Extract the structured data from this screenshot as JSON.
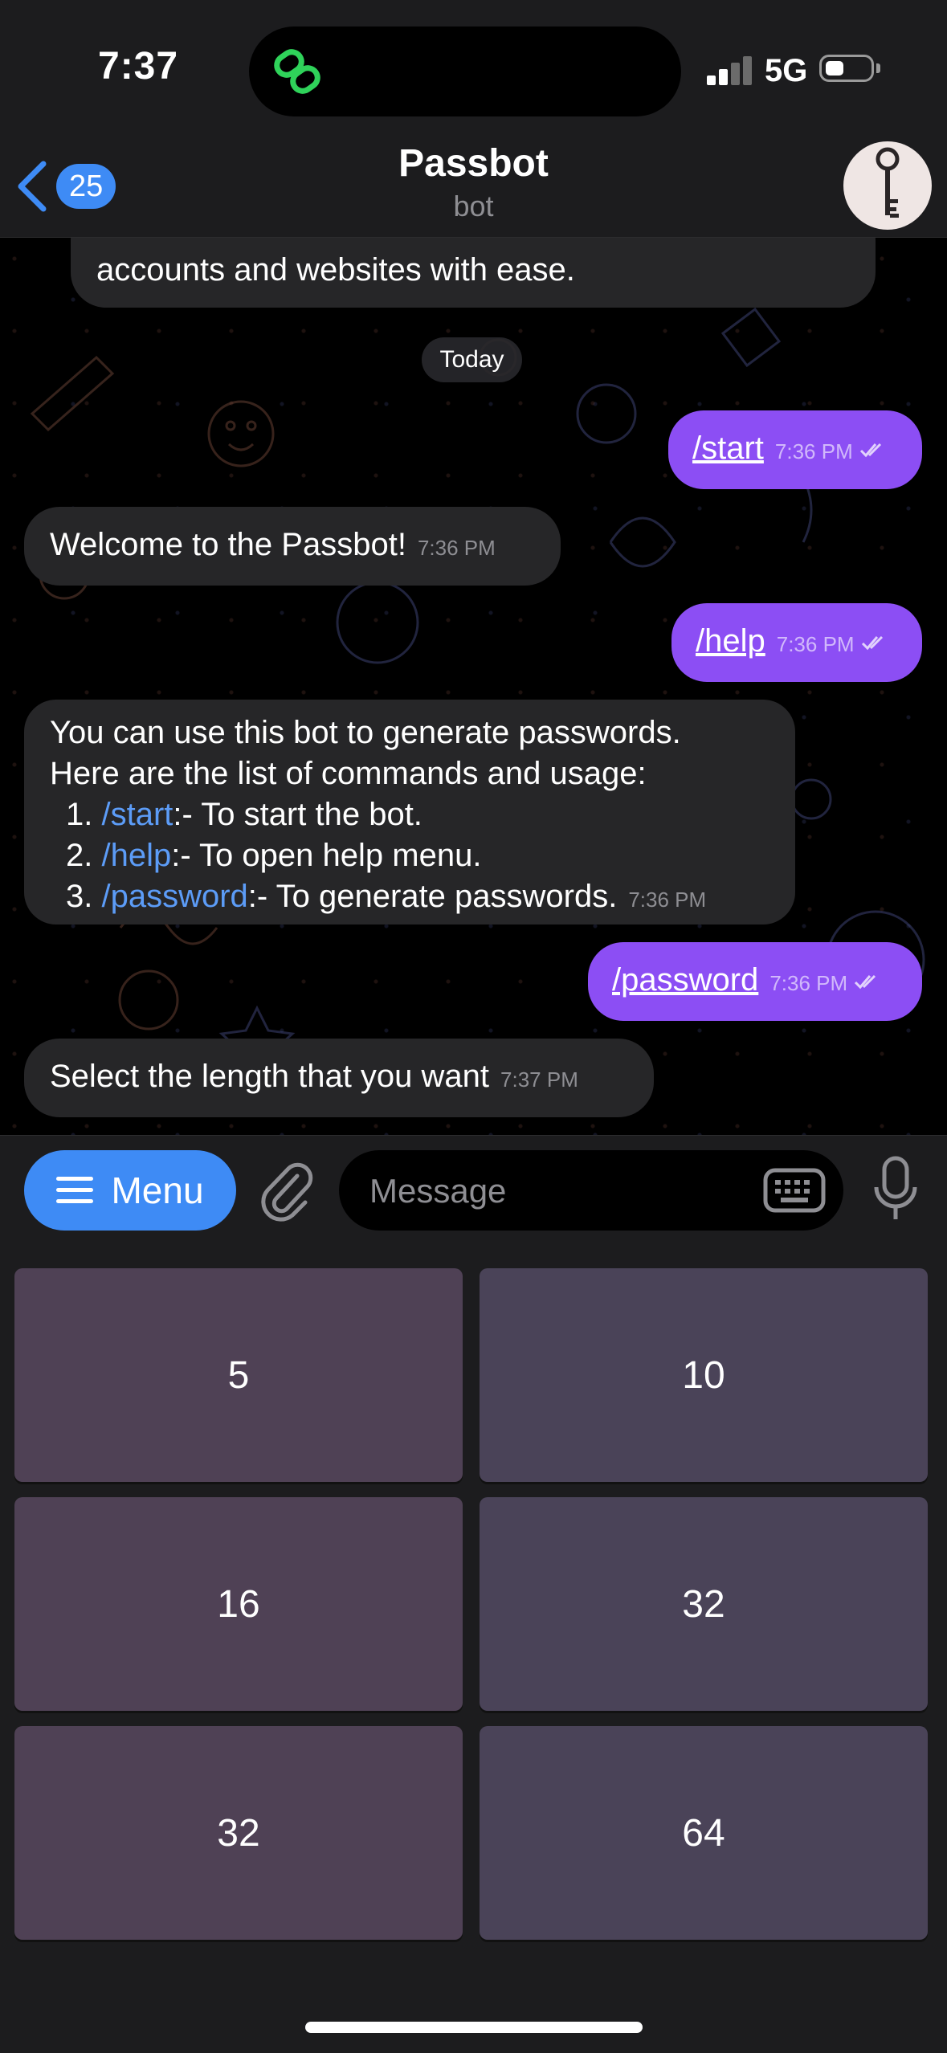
{
  "status_bar": {
    "time": "7:37",
    "network": "5G"
  },
  "header": {
    "back_badge": "25",
    "title": "Passbot",
    "subtitle": "bot"
  },
  "chat": {
    "intro_fragment": "accounts and websites with ease.",
    "date_divider": "Today",
    "messages": [
      {
        "dir": "out",
        "text": "/start",
        "time": "7:36 PM"
      },
      {
        "dir": "in",
        "text": "Welcome to the Passbot!",
        "time": "7:36 PM"
      },
      {
        "dir": "out",
        "text": "/help",
        "time": "7:36 PM"
      },
      {
        "dir": "in",
        "line1": "You can use this bot to generate passwords.",
        "line2": "Here are the list of commands and usage:",
        "items": [
          {
            "num": "1.",
            "cmd": "/start",
            "desc": ":- To start the bot."
          },
          {
            "num": "2.",
            "cmd": "/help",
            "desc": ":- To open help menu."
          },
          {
            "num": "3.",
            "cmd": "/password",
            "desc": ":- To generate passwords."
          }
        ],
        "time": "7:36 PM"
      },
      {
        "dir": "out",
        "text": "/password",
        "time": "7:36 PM"
      },
      {
        "dir": "in",
        "text": "Select the length that you want",
        "time": "7:37 PM"
      }
    ]
  },
  "input_bar": {
    "menu_label": "Menu",
    "placeholder": "Message"
  },
  "keyboard": {
    "buttons": [
      "5",
      "10",
      "16",
      "32",
      "32",
      "64"
    ]
  },
  "colors": {
    "outgoing": "#8c4ef4",
    "incoming": "#262628",
    "accent": "#3e8bf5",
    "key_left": "#4f4155",
    "key_right": "#4a4358"
  },
  "icons": [
    "link-icon",
    "signal-icon",
    "battery-icon",
    "back-chevron-icon",
    "key-avatar",
    "menu-lines-icon",
    "paperclip-icon",
    "keyboard-icon",
    "microphone-icon",
    "double-check-icon"
  ]
}
